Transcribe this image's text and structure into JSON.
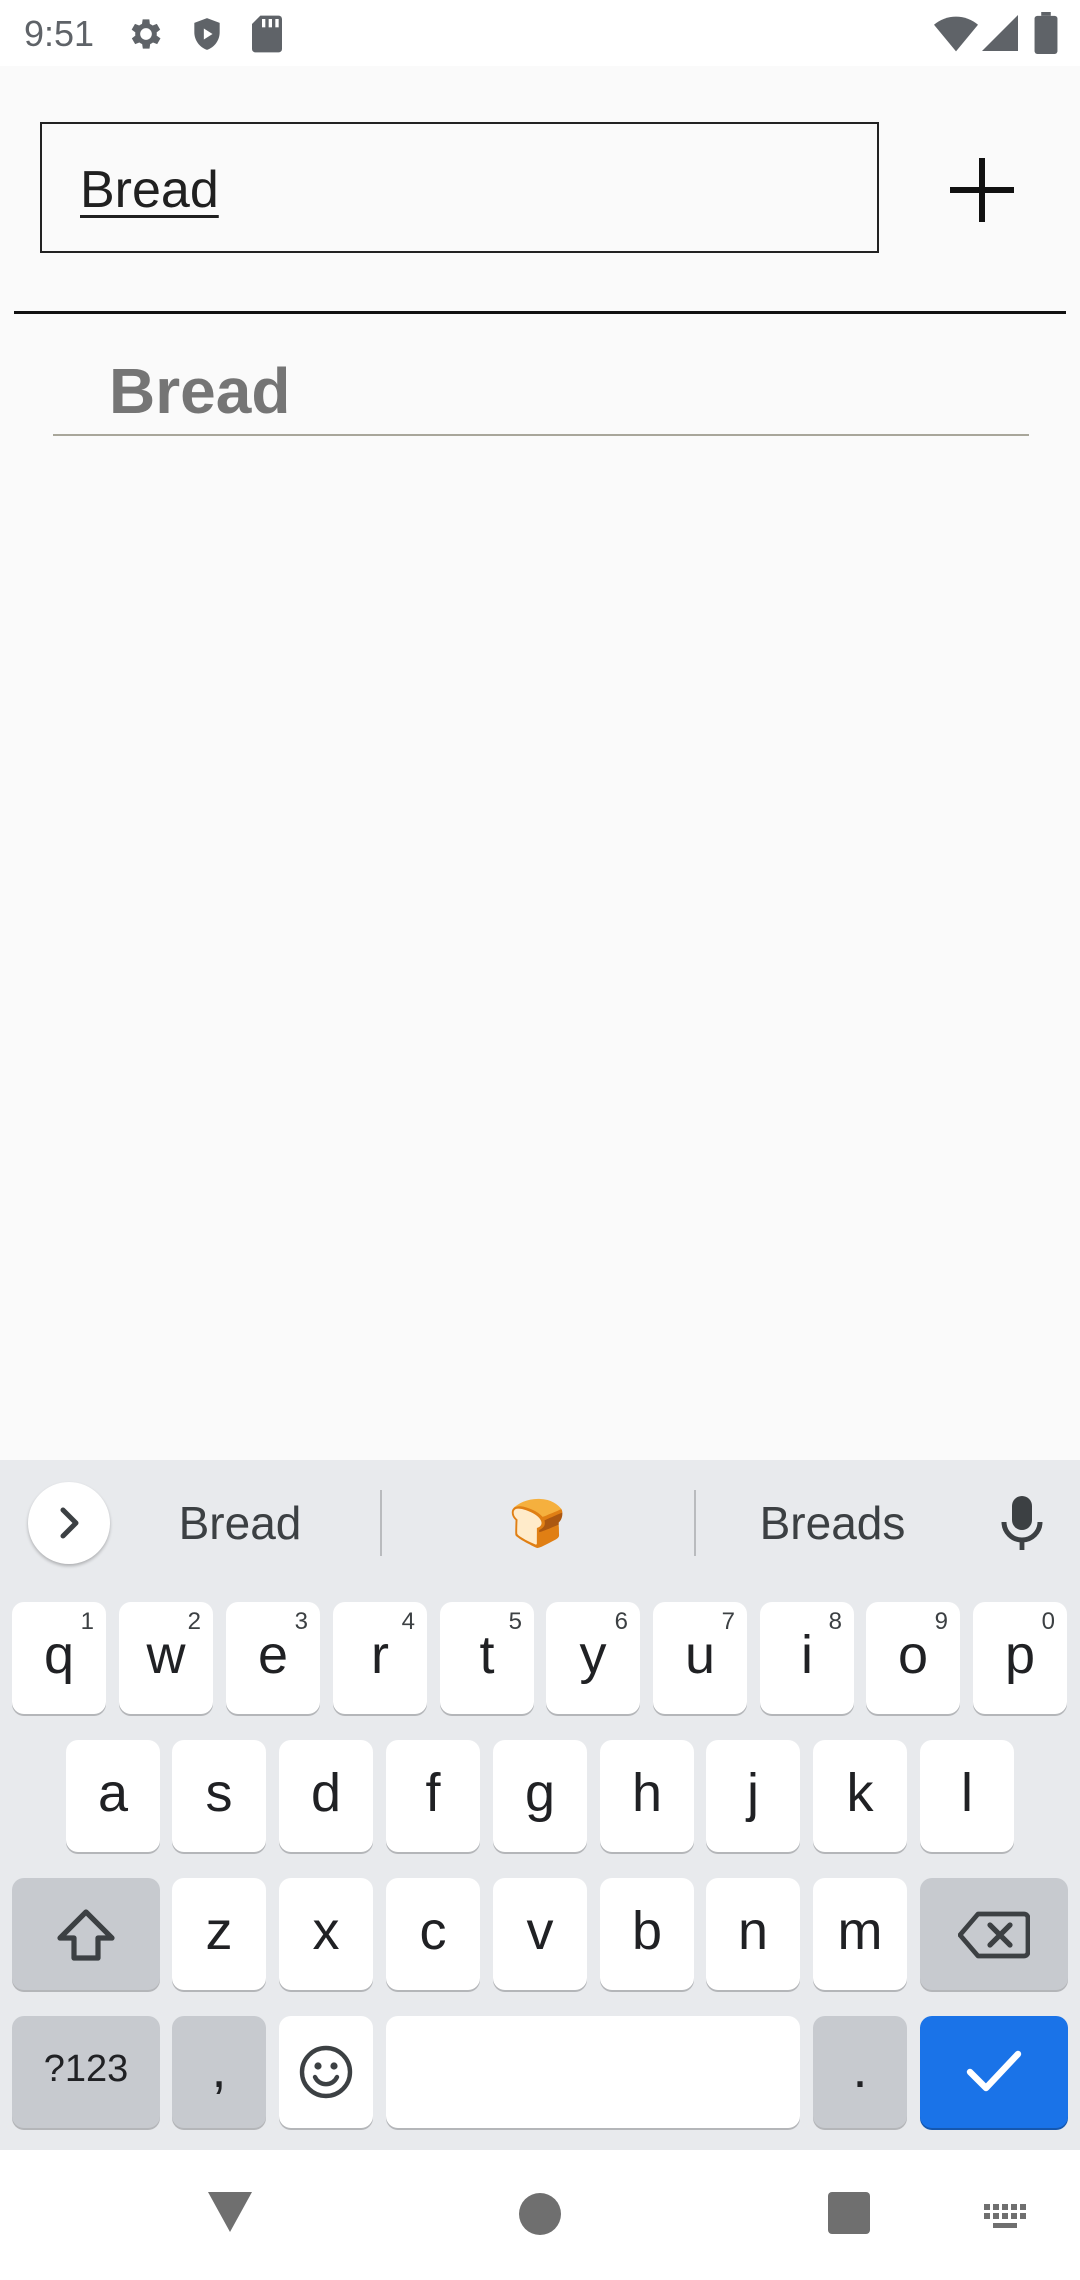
{
  "status_bar": {
    "time": "9:51",
    "icons": [
      "gear-icon",
      "shield-icon",
      "sd-card-icon",
      "wifi-icon",
      "signal-icon",
      "battery-icon"
    ]
  },
  "app": {
    "input_value": "Bread",
    "add_icon": "plus-icon",
    "list_items": [
      "Bread"
    ]
  },
  "keyboard": {
    "suggestions": [
      "Bread",
      "🍞",
      "Breads"
    ],
    "row1": [
      {
        "label": "q",
        "hint": "1"
      },
      {
        "label": "w",
        "hint": "2"
      },
      {
        "label": "e",
        "hint": "3"
      },
      {
        "label": "r",
        "hint": "4"
      },
      {
        "label": "t",
        "hint": "5"
      },
      {
        "label": "y",
        "hint": "6"
      },
      {
        "label": "u",
        "hint": "7"
      },
      {
        "label": "i",
        "hint": "8"
      },
      {
        "label": "o",
        "hint": "9"
      },
      {
        "label": "p",
        "hint": "0"
      }
    ],
    "row2": [
      "a",
      "s",
      "d",
      "f",
      "g",
      "h",
      "j",
      "k",
      "l"
    ],
    "row3": [
      "z",
      "x",
      "c",
      "v",
      "b",
      "n",
      "m"
    ],
    "symbols_label": "?123",
    "comma_label": ",",
    "period_label": ".",
    "colors": {
      "enter": "#1a73e8",
      "background": "#e8eaed"
    }
  }
}
